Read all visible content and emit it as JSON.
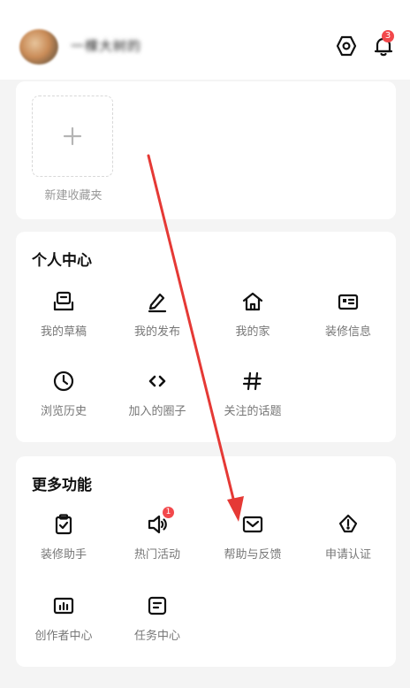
{
  "header": {
    "username": "一棵大树的",
    "settings_icon": "hexagon-settings-icon",
    "notification_icon": "bell-icon",
    "notification_count": "3"
  },
  "favorites": {
    "new_folder_label": "新建收藏夹",
    "plus_icon": "plus-icon"
  },
  "personal_center": {
    "title": "个人中心",
    "items": [
      {
        "label": "我的草稿",
        "icon": "draft-icon"
      },
      {
        "label": "我的发布",
        "icon": "pen-icon"
      },
      {
        "label": "我的家",
        "icon": "home-icon"
      },
      {
        "label": "装修信息",
        "icon": "id-card-icon"
      },
      {
        "label": "浏览历史",
        "icon": "clock-icon"
      },
      {
        "label": "加入的圈子",
        "icon": "code-brackets-icon"
      },
      {
        "label": "关注的话题",
        "icon": "hashtag-icon"
      }
    ]
  },
  "more_features": {
    "title": "更多功能",
    "items": [
      {
        "label": "装修助手",
        "icon": "clipboard-check-icon"
      },
      {
        "label": "热门活动",
        "icon": "megaphone-icon",
        "badge": "1"
      },
      {
        "label": "帮助与反馈",
        "icon": "mail-icon"
      },
      {
        "label": "申请认证",
        "icon": "certification-icon"
      },
      {
        "label": "创作者中心",
        "icon": "chart-icon"
      },
      {
        "label": "任务中心",
        "icon": "task-list-icon"
      }
    ]
  },
  "colors": {
    "badge": "#f2484b",
    "annotation_arrow": "#e53935"
  }
}
